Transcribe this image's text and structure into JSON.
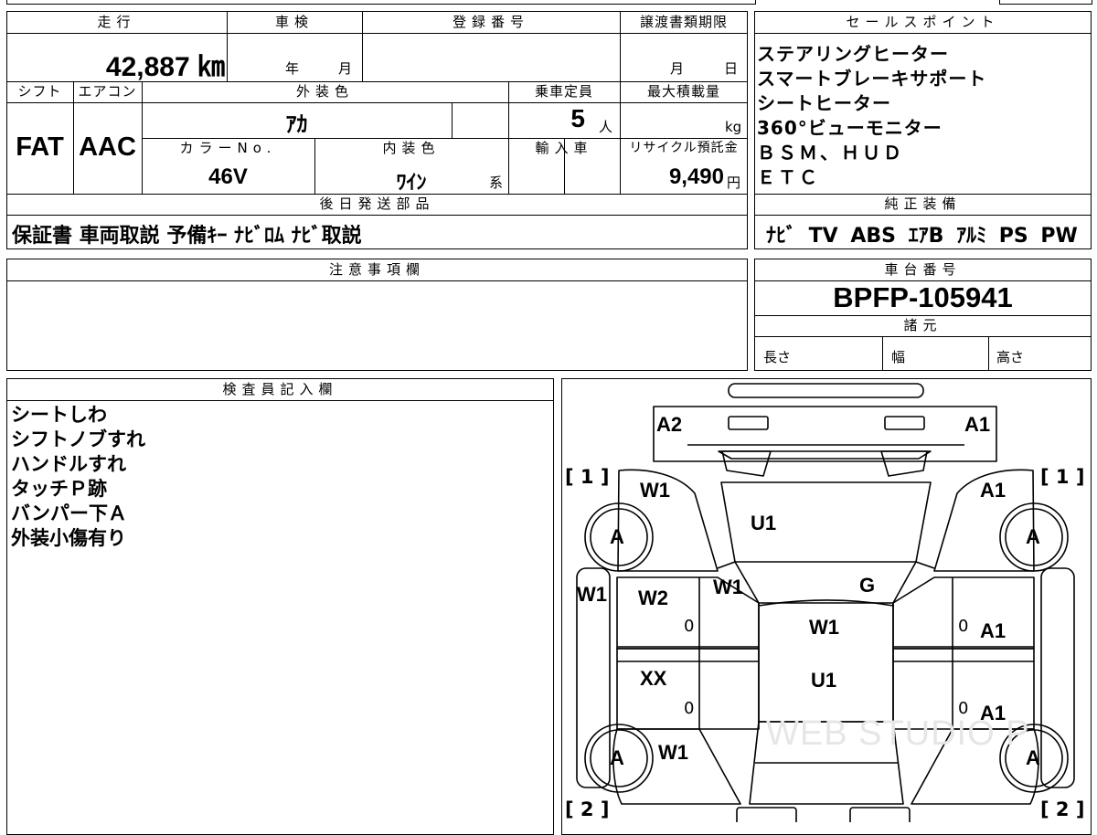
{
  "header": {
    "mileage": "走行",
    "inspection": "車検",
    "registration_no": "登録番号",
    "transfer_deadline": "譲渡書類期限",
    "sales_points": "セールスポイント",
    "shift": "シフト",
    "aircon": "エアコン",
    "exterior_color": "外装色",
    "capacity": "乗車定員",
    "max_load": "最大積載量",
    "color_no": "カラーNo.",
    "interior_color": "内装色",
    "import": "輸入車",
    "recycle_fee": "リサイクル預託金",
    "later_parts": "後日発送部品",
    "genuine_equipment": "純正装備",
    "notes": "注意事項欄",
    "chassis_no": "車台番号",
    "specs": "諸元",
    "inspector": "検査員記入欄"
  },
  "units": {
    "year": "年",
    "month": "月",
    "day": "日",
    "person": "人",
    "kg": "kg",
    "yen": "円",
    "kei": "系",
    "length": "長さ",
    "width": "幅",
    "height": "高さ"
  },
  "values": {
    "mileage": "42,887 ㎞",
    "shift": "FAT",
    "aircon": "AAC",
    "exterior_color": "ｱｶ",
    "capacity": "5",
    "color_no": "46V",
    "interior_color": "ﾜｲﾝ",
    "recycle_fee": "9,490",
    "later_parts": "保証書 車両取説 予備ｷｰ ﾅﾋﾞﾛﾑ ﾅﾋﾞ取説",
    "genuine_equipment": "ﾅﾋﾞ TV ABS ｴｱB ｱﾙﾐ PS PW",
    "chassis_no": "BPFP-105941"
  },
  "sales_points": [
    "ステアリングヒーター",
    "スマートブレーキサポート",
    "シートヒーター",
    "360°ビューモニター",
    "ＢＳＭ、ＨＵＤ",
    "ＥＴＣ"
  ],
  "inspector_notes": [
    "シートしわ",
    "シフトノブすれ",
    "ハンドルすれ",
    "タッチＰ跡",
    "バンパー下Ａ",
    "外装小傷有り"
  ],
  "diagram": {
    "labels": [
      "A2",
      "A1",
      "W1",
      "A1",
      "U1",
      "A",
      "A",
      "W1",
      "W2",
      "W1",
      "G",
      "W1",
      "A1",
      "XX",
      "U1",
      "A1",
      "A",
      "W1",
      "A"
    ],
    "brackets": [
      "[ 1 ]",
      "[ 1 ]",
      "[ 2 ]",
      "[ 2 ]"
    ],
    "zeros": [
      "0",
      "0",
      "0",
      "0"
    ]
  },
  "watermark": "WEB STUDIO P"
}
